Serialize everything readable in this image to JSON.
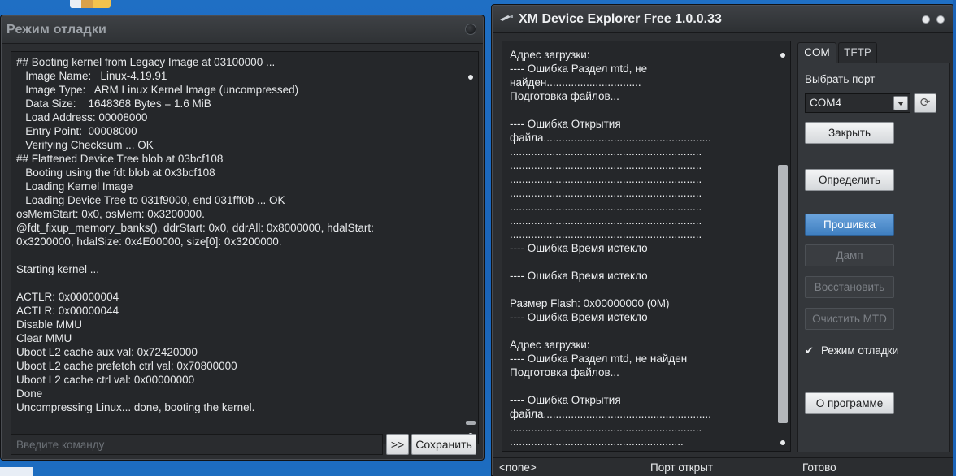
{
  "debug_window": {
    "title": "Режим отладки",
    "console_lines": [
      "## Booting kernel from Legacy Image at 03100000 ...",
      "   Image Name:   Linux-4.19.91",
      "   Image Type:   ARM Linux Kernel Image (uncompressed)",
      "   Data Size:    1648368 Bytes = 1.6 MiB",
      "   Load Address: 00008000",
      "   Entry Point:  00008000",
      "   Verifying Checksum ... OK",
      "## Flattened Device Tree blob at 03bcf108",
      "   Booting using the fdt blob at 0x3bcf108",
      "   Loading Kernel Image",
      "   Loading Device Tree to 031f9000, end 031fff0b ... OK",
      "osMemStart: 0x0, osMem: 0x3200000.",
      "@fdt_fixup_memory_banks(), ddrStart: 0x0, ddrAll: 0x8000000, hdalStart:",
      "0x3200000, hdalSize: 0x4E00000, size[0]: 0x3200000.",
      "",
      "Starting kernel ...",
      "",
      "ACTLR: 0x00000004",
      "ACTLR: 0x00000044",
      "Disable MMU",
      "Clear MMU",
      "Uboot L2 cache aux val: 0x72420000",
      "Uboot L2 cache prefetch ctrl val: 0x70800000",
      "Uboot L2 cache ctrl val: 0x00000000",
      "Done",
      "Uncompressing Linux... done, booting the kernel."
    ],
    "command_placeholder": "Введите команду",
    "send_label": ">>",
    "save_label": "Сохранить"
  },
  "xm_window": {
    "title": "XM Device Explorer Free 1.0.0.33",
    "log_lines": [
      "Адрес загрузки:",
      "---- Ошибка Раздел mtd, не",
      "найден...............................",
      "Подготовка файлов...",
      "",
      "---- Ошибка Открытия",
      "файла.......................................................",
      "...............................................................",
      "...............................................................",
      "...............................................................",
      "...............................................................",
      "...............................................................",
      "...............................................................",
      "...............................................................",
      "---- Ошибка Время истекло",
      "",
      "---- Ошибка Время истекло",
      "",
      "Размер Flash: 0x00000000 (0M)",
      "---- Ошибка Время истекло",
      "",
      "Адрес загрузки:",
      "---- Ошибка Раздел mtd, не найден",
      "Подготовка файлов...",
      "",
      "---- Ошибка Открытия",
      "файла.......................................................",
      "...............................................................",
      "........................................................."
    ],
    "tabs": [
      "COM",
      "TFTP"
    ],
    "port_label": "Выбрать порт",
    "port_value": "COM4",
    "buttons": {
      "close": "Закрыть",
      "detect": "Определить",
      "flash": "Прошивка",
      "dump": "Дамп",
      "restore": "Восстановить",
      "clear_mtd": "Очистить MTD",
      "about": "О программе"
    },
    "debug_mode_label": "Режим отладки",
    "debug_mode_checked": true,
    "status": {
      "left": "<none>",
      "middle": "Порт открыт",
      "right": "Готово"
    }
  },
  "colors": {
    "accent_blue": "#4f8fd0",
    "window_bg": "#2c2e31",
    "desktop": "#1f6fc4"
  }
}
